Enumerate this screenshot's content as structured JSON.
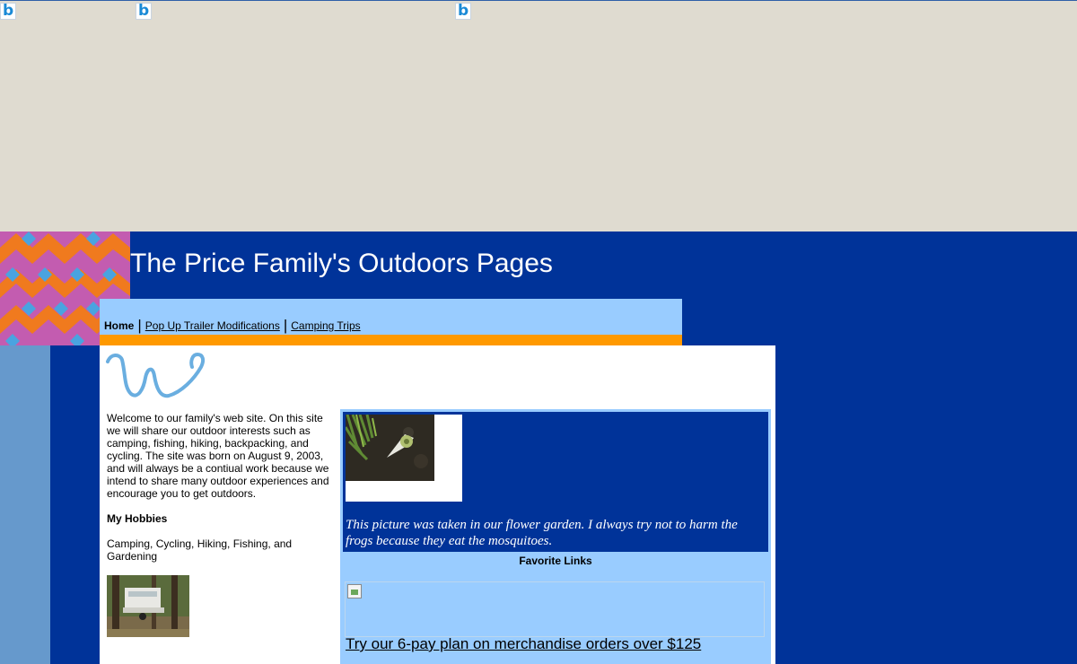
{
  "site": {
    "title": "The Price Family's Outdoors Pages"
  },
  "nav": {
    "home": "Home",
    "separator": "|",
    "items": [
      "Pop Up Trailer Modifications",
      "Camping Trips"
    ]
  },
  "intro": {
    "welcome": "Welcome to our family's web site.  On this site we will share our outdoor interests such as camping, fishing, hiking, backpacking, and cycling.  The site was born on August 9, 2003, and will always be a contiual work because we intend to share many outdoor experiences and encourage you to get outdoors.",
    "hobbies_title": "My Hobbies",
    "hobbies_text": "Camping, Cycling, Hiking, Fishing, and Gardening"
  },
  "feature": {
    "caption": "This picture was taken in our flower garden.  I always try not to harm the frogs because they eat the mosquitoes."
  },
  "links": {
    "title": "Favorite Links",
    "promo": "Try our 6-pay plan on merchandise orders over $125"
  },
  "colors": {
    "page_bg": "#003399",
    "top_band": "#dfdbd0",
    "nav_bg": "#99ccff",
    "accent_bar": "#ff9900",
    "left_strip": "#6699cc",
    "logo_stroke": "#6aaee0"
  },
  "icons": {
    "badge": "bing-icon",
    "badge_glyph": "b",
    "logo": "w-script-logo"
  }
}
